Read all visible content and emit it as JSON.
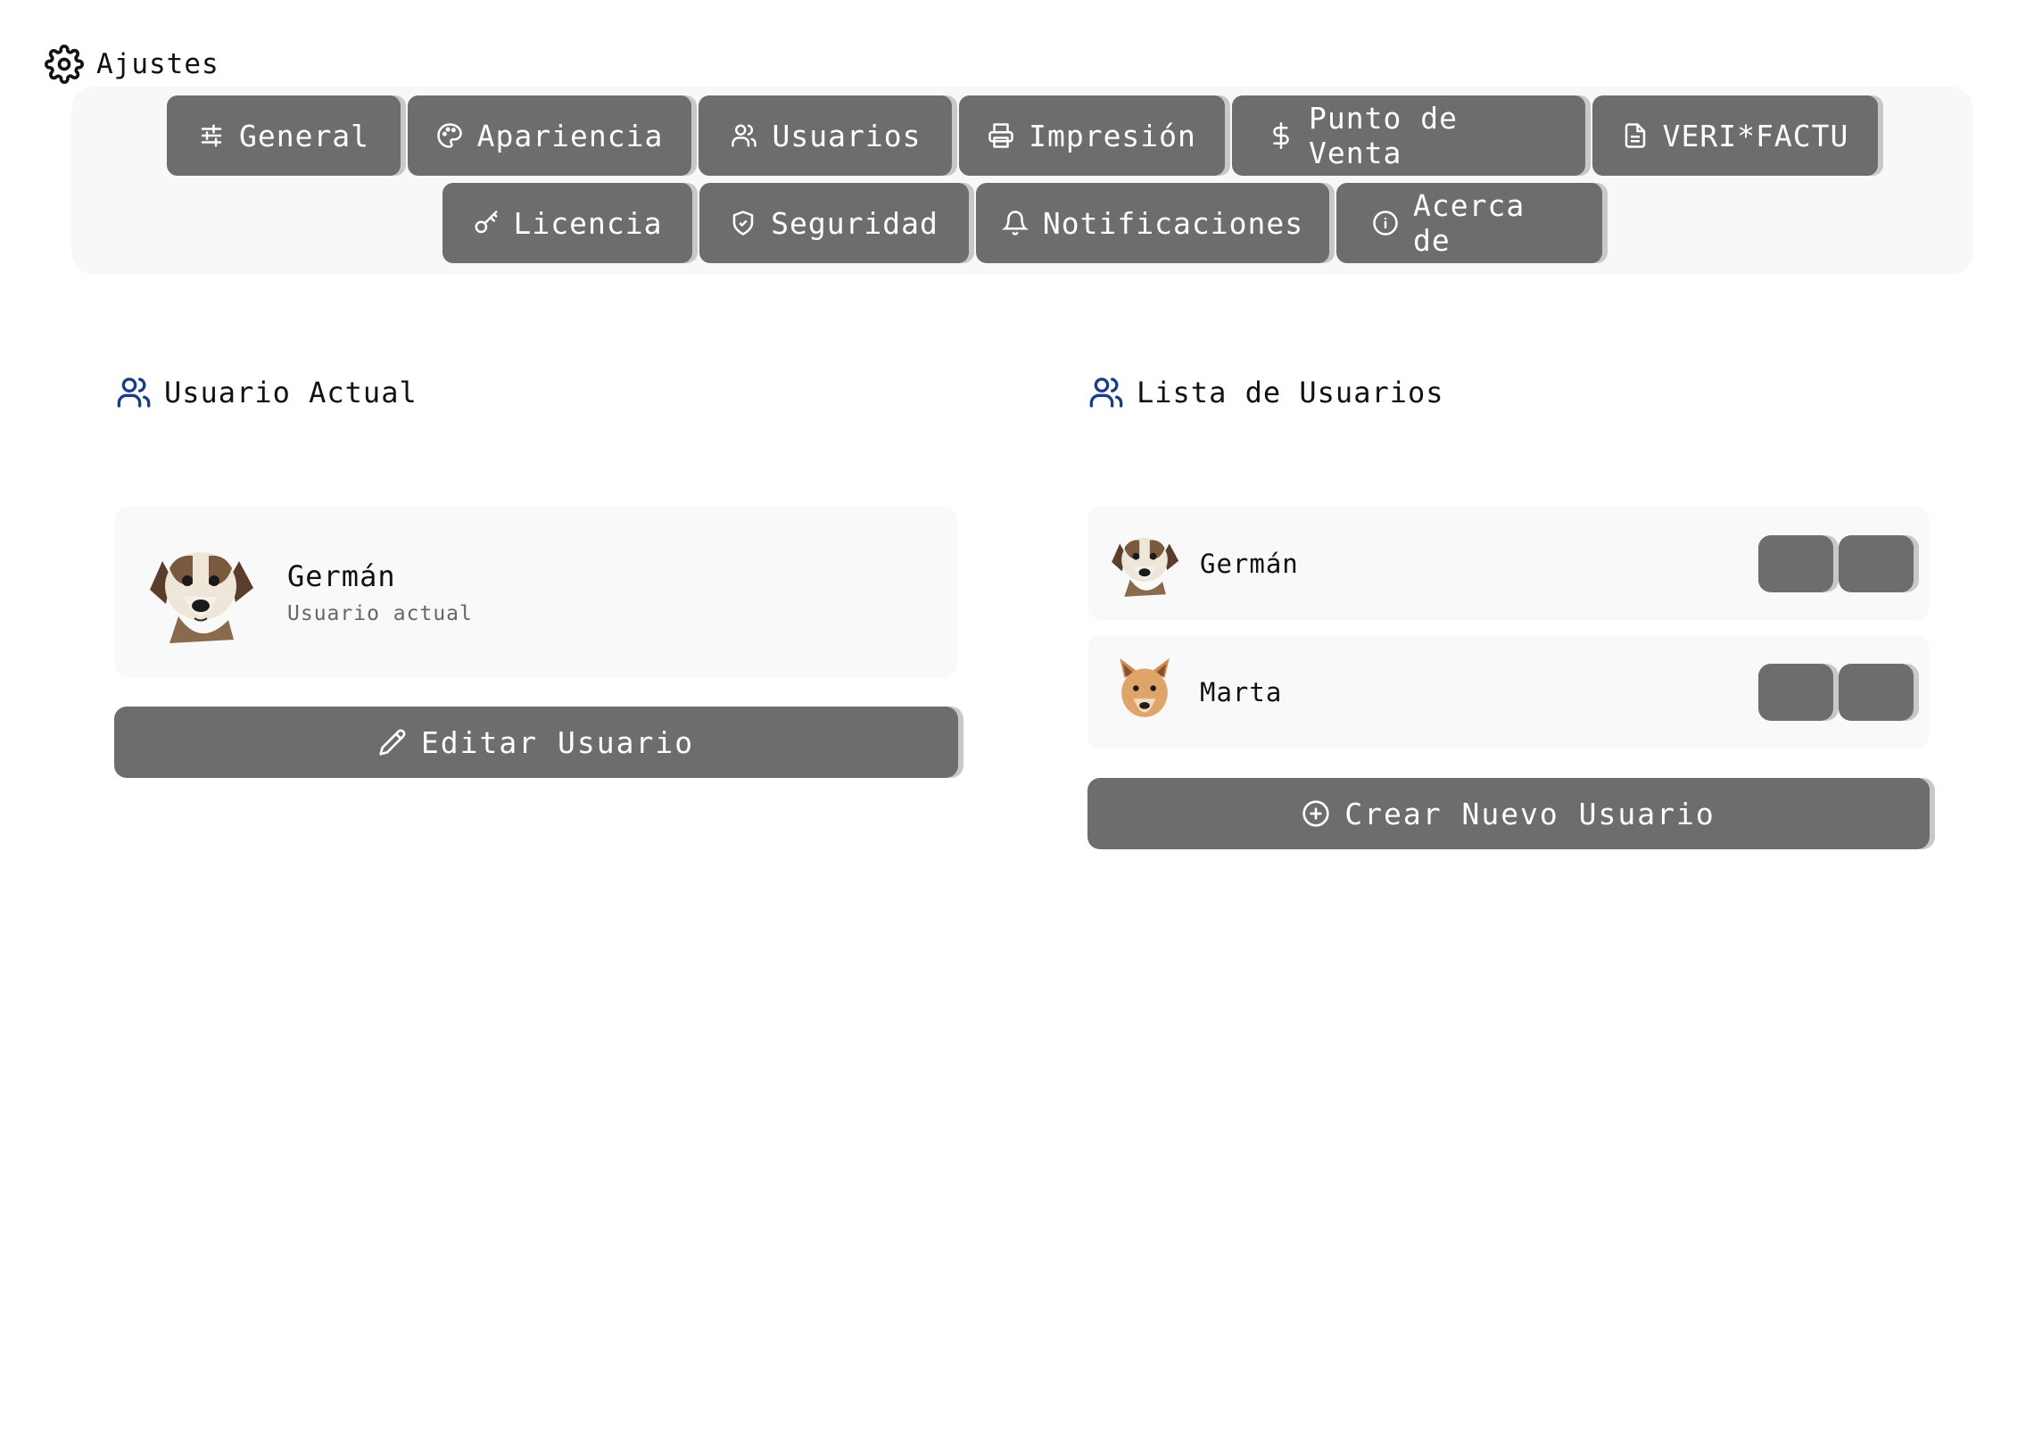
{
  "header": {
    "title": "Ajustes",
    "icon": "gear-icon"
  },
  "tabs": {
    "row1": [
      {
        "label": "General",
        "icon": "sliders-icon"
      },
      {
        "label": "Apariencia",
        "icon": "palette-icon"
      },
      {
        "label": "Usuarios",
        "icon": "users-icon"
      },
      {
        "label": "Impresión",
        "icon": "printer-icon"
      },
      {
        "label": "Punto de Venta",
        "icon": "dollar-icon"
      },
      {
        "label": "VERI*FACTU",
        "icon": "document-icon"
      }
    ],
    "row2": [
      {
        "label": "Licencia",
        "icon": "key-icon"
      },
      {
        "label": "Seguridad",
        "icon": "shield-icon"
      },
      {
        "label": "Notificaciones",
        "icon": "bell-icon"
      },
      {
        "label": "Acerca de",
        "icon": "info-icon"
      }
    ]
  },
  "current_user": {
    "heading": "Usuario Actual",
    "name": "Germán",
    "subtitle": "Usuario actual",
    "edit_label": "Editar Usuario"
  },
  "user_list": {
    "heading": "Lista de Usuarios",
    "users": [
      {
        "name": "Germán"
      },
      {
        "name": "Marta"
      }
    ],
    "create_label": "Crear Nuevo Usuario"
  },
  "colors": {
    "button_bg": "#6d6d6d",
    "heading_icon": "#1e3a8a",
    "panel_bg": "#f8f8f8"
  }
}
